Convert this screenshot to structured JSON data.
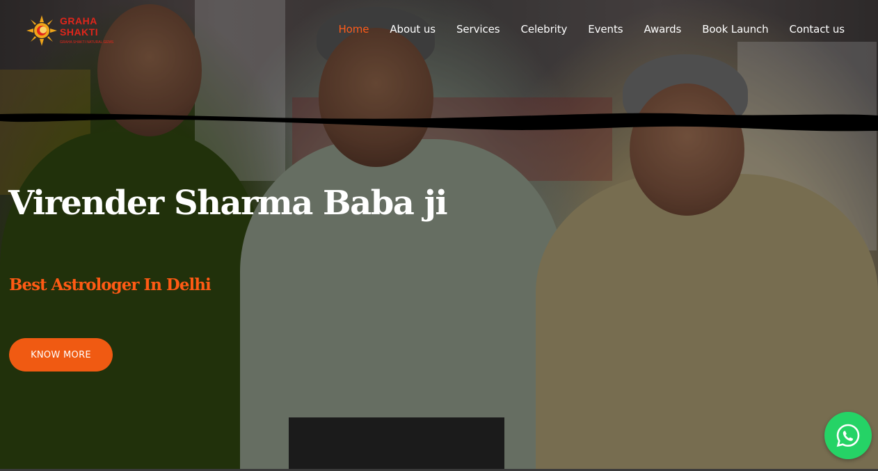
{
  "logo": {
    "line1": "GRAHA",
    "line2": "SHAKTI",
    "tagline": "GRAHA SHAKTI NATURAL GEMS"
  },
  "nav": {
    "items": [
      {
        "label": "Home",
        "active": true
      },
      {
        "label": "About us",
        "active": false
      },
      {
        "label": "Services",
        "active": false
      },
      {
        "label": "Celebrity",
        "active": false
      },
      {
        "label": "Events",
        "active": false
      },
      {
        "label": "Awards",
        "active": false
      },
      {
        "label": "Book Launch",
        "active": false
      },
      {
        "label": "Contact us",
        "active": false
      }
    ]
  },
  "hero": {
    "title": "Virender Sharma Baba ji",
    "subtitle": "Best Astrologer In Delhi",
    "cta_label": "KNOW MORE"
  },
  "whatsapp": {
    "icon": "whatsapp-icon"
  },
  "colors": {
    "accent": "#ff5a14",
    "cta": "#f05a12",
    "whatsapp": "#25d366",
    "logo": "#e0261b"
  }
}
